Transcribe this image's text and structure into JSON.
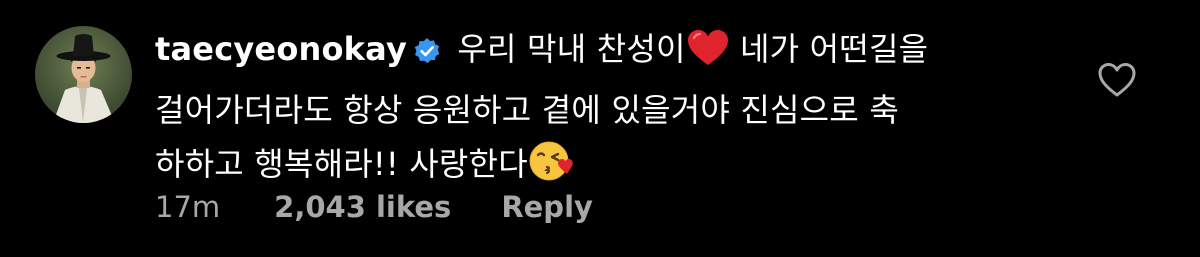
{
  "comment": {
    "username": "taecyeonokay",
    "verified": true,
    "text_line1": " 우리 막내 찬성이",
    "text_line1b": "  네가 어떤길을",
    "text_line2": "걸어가더라도 항상 응원하고 곁에 있을거야 진심으로 축",
    "text_line3": "하하고 행복해라!! 사랑한다",
    "time": "17m",
    "likes": "2,043 likes",
    "reply": "Reply"
  },
  "icons": {
    "avatar": "profile-photo",
    "verified": "verified-badge-icon",
    "emoji_heart": "red-heart-emoji",
    "emoji_kiss": "face-blowing-kiss-emoji",
    "like": "heart-outline-icon"
  },
  "colors": {
    "background": "#000000",
    "text": "#ffffff",
    "meta": "#a8a8a8",
    "verified": "#3897f0",
    "heart_emoji": "#e0242d"
  }
}
